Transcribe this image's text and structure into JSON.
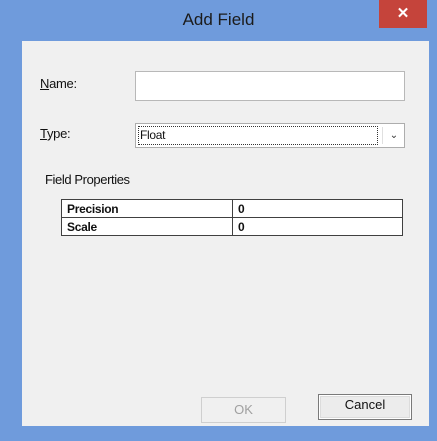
{
  "window": {
    "title": "Add Field",
    "close_glyph": "✕"
  },
  "form": {
    "name_label_accel": "N",
    "name_label_rest": "ame:",
    "name_value": "",
    "type_label_accel": "T",
    "type_label_rest": "ype:",
    "type_selected": "Float",
    "chevron_glyph": "⌄"
  },
  "field_properties": {
    "label": "Field Properties",
    "rows": [
      {
        "name": "Precision",
        "value": "0"
      },
      {
        "name": "Scale",
        "value": "0"
      }
    ]
  },
  "buttons": {
    "ok": "OK",
    "cancel": "Cancel"
  },
  "colors": {
    "frame": "#6f9bdc",
    "close_button": "#c5443b",
    "client": "#f0f0f0"
  }
}
